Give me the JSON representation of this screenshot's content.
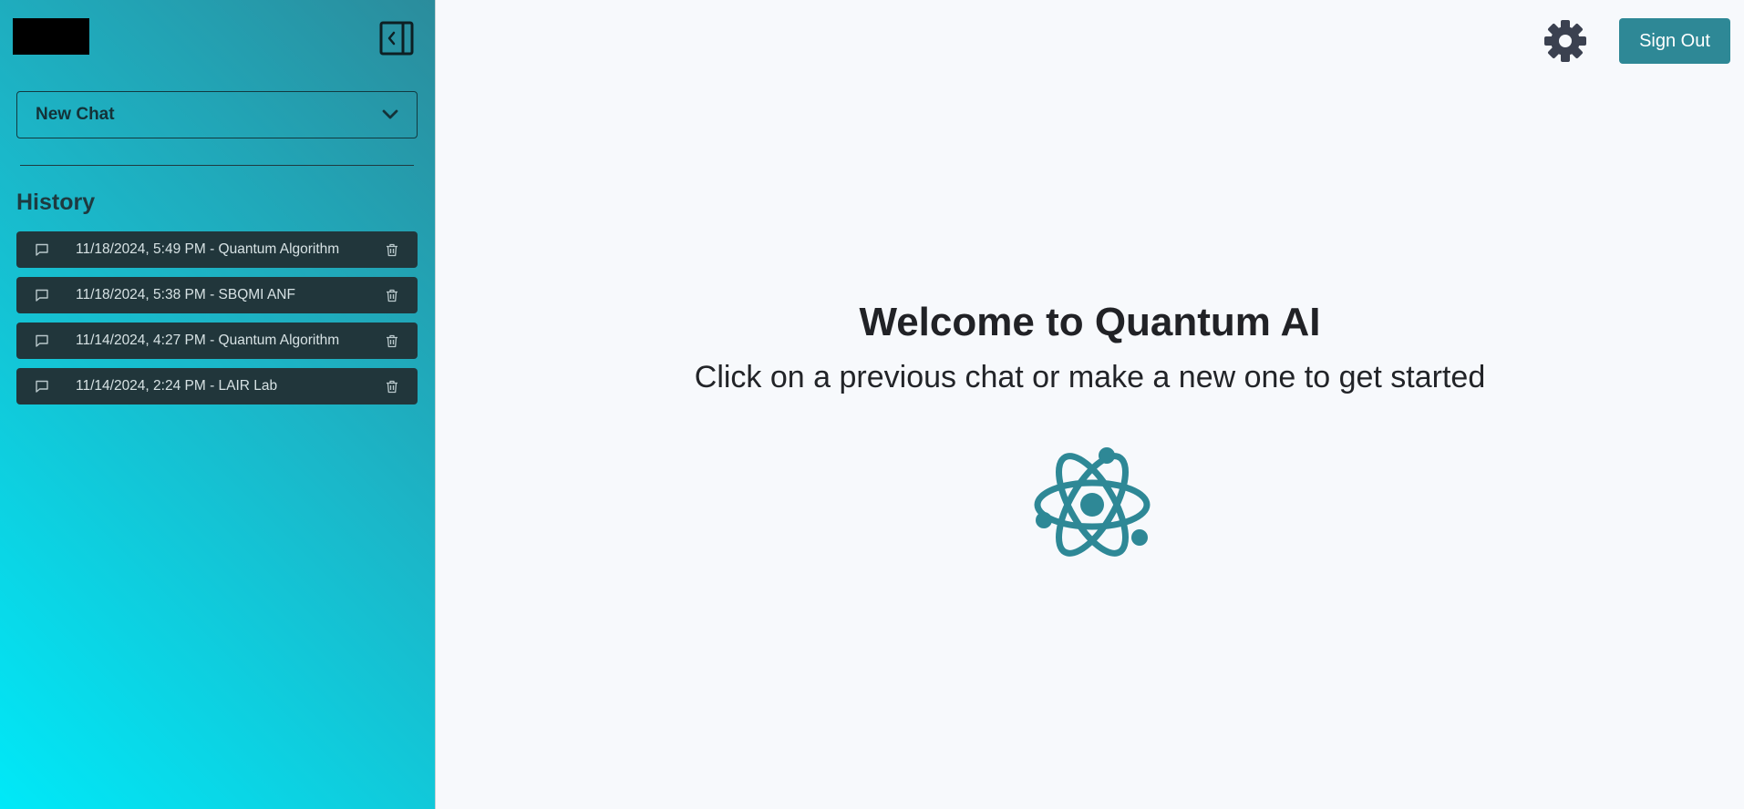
{
  "sidebar": {
    "new_chat_label": "New Chat",
    "history_title": "History",
    "history_items": [
      {
        "label": "11/18/2024, 5:49 PM - Quantum Algorithm"
      },
      {
        "label": "11/18/2024, 5:38 PM - SBQMI ANF"
      },
      {
        "label": "11/14/2024, 4:27 PM - Quantum Algorithm"
      },
      {
        "label": "11/14/2024, 2:24 PM - LAIR Lab"
      }
    ]
  },
  "header": {
    "sign_out_label": "Sign Out",
    "settings_icon": "gear-icon"
  },
  "main": {
    "title": "Welcome to Quantum AI",
    "subtitle": "Click on a previous chat or make a new one to get started",
    "icon": "atom-icon"
  },
  "colors": {
    "accent": "#2e8896",
    "sidebar_gradient_start": "#00e9f8",
    "sidebar_gradient_end": "#2b8c9c",
    "history_item_bg": "#21363b",
    "background": "#f7f9fc"
  }
}
